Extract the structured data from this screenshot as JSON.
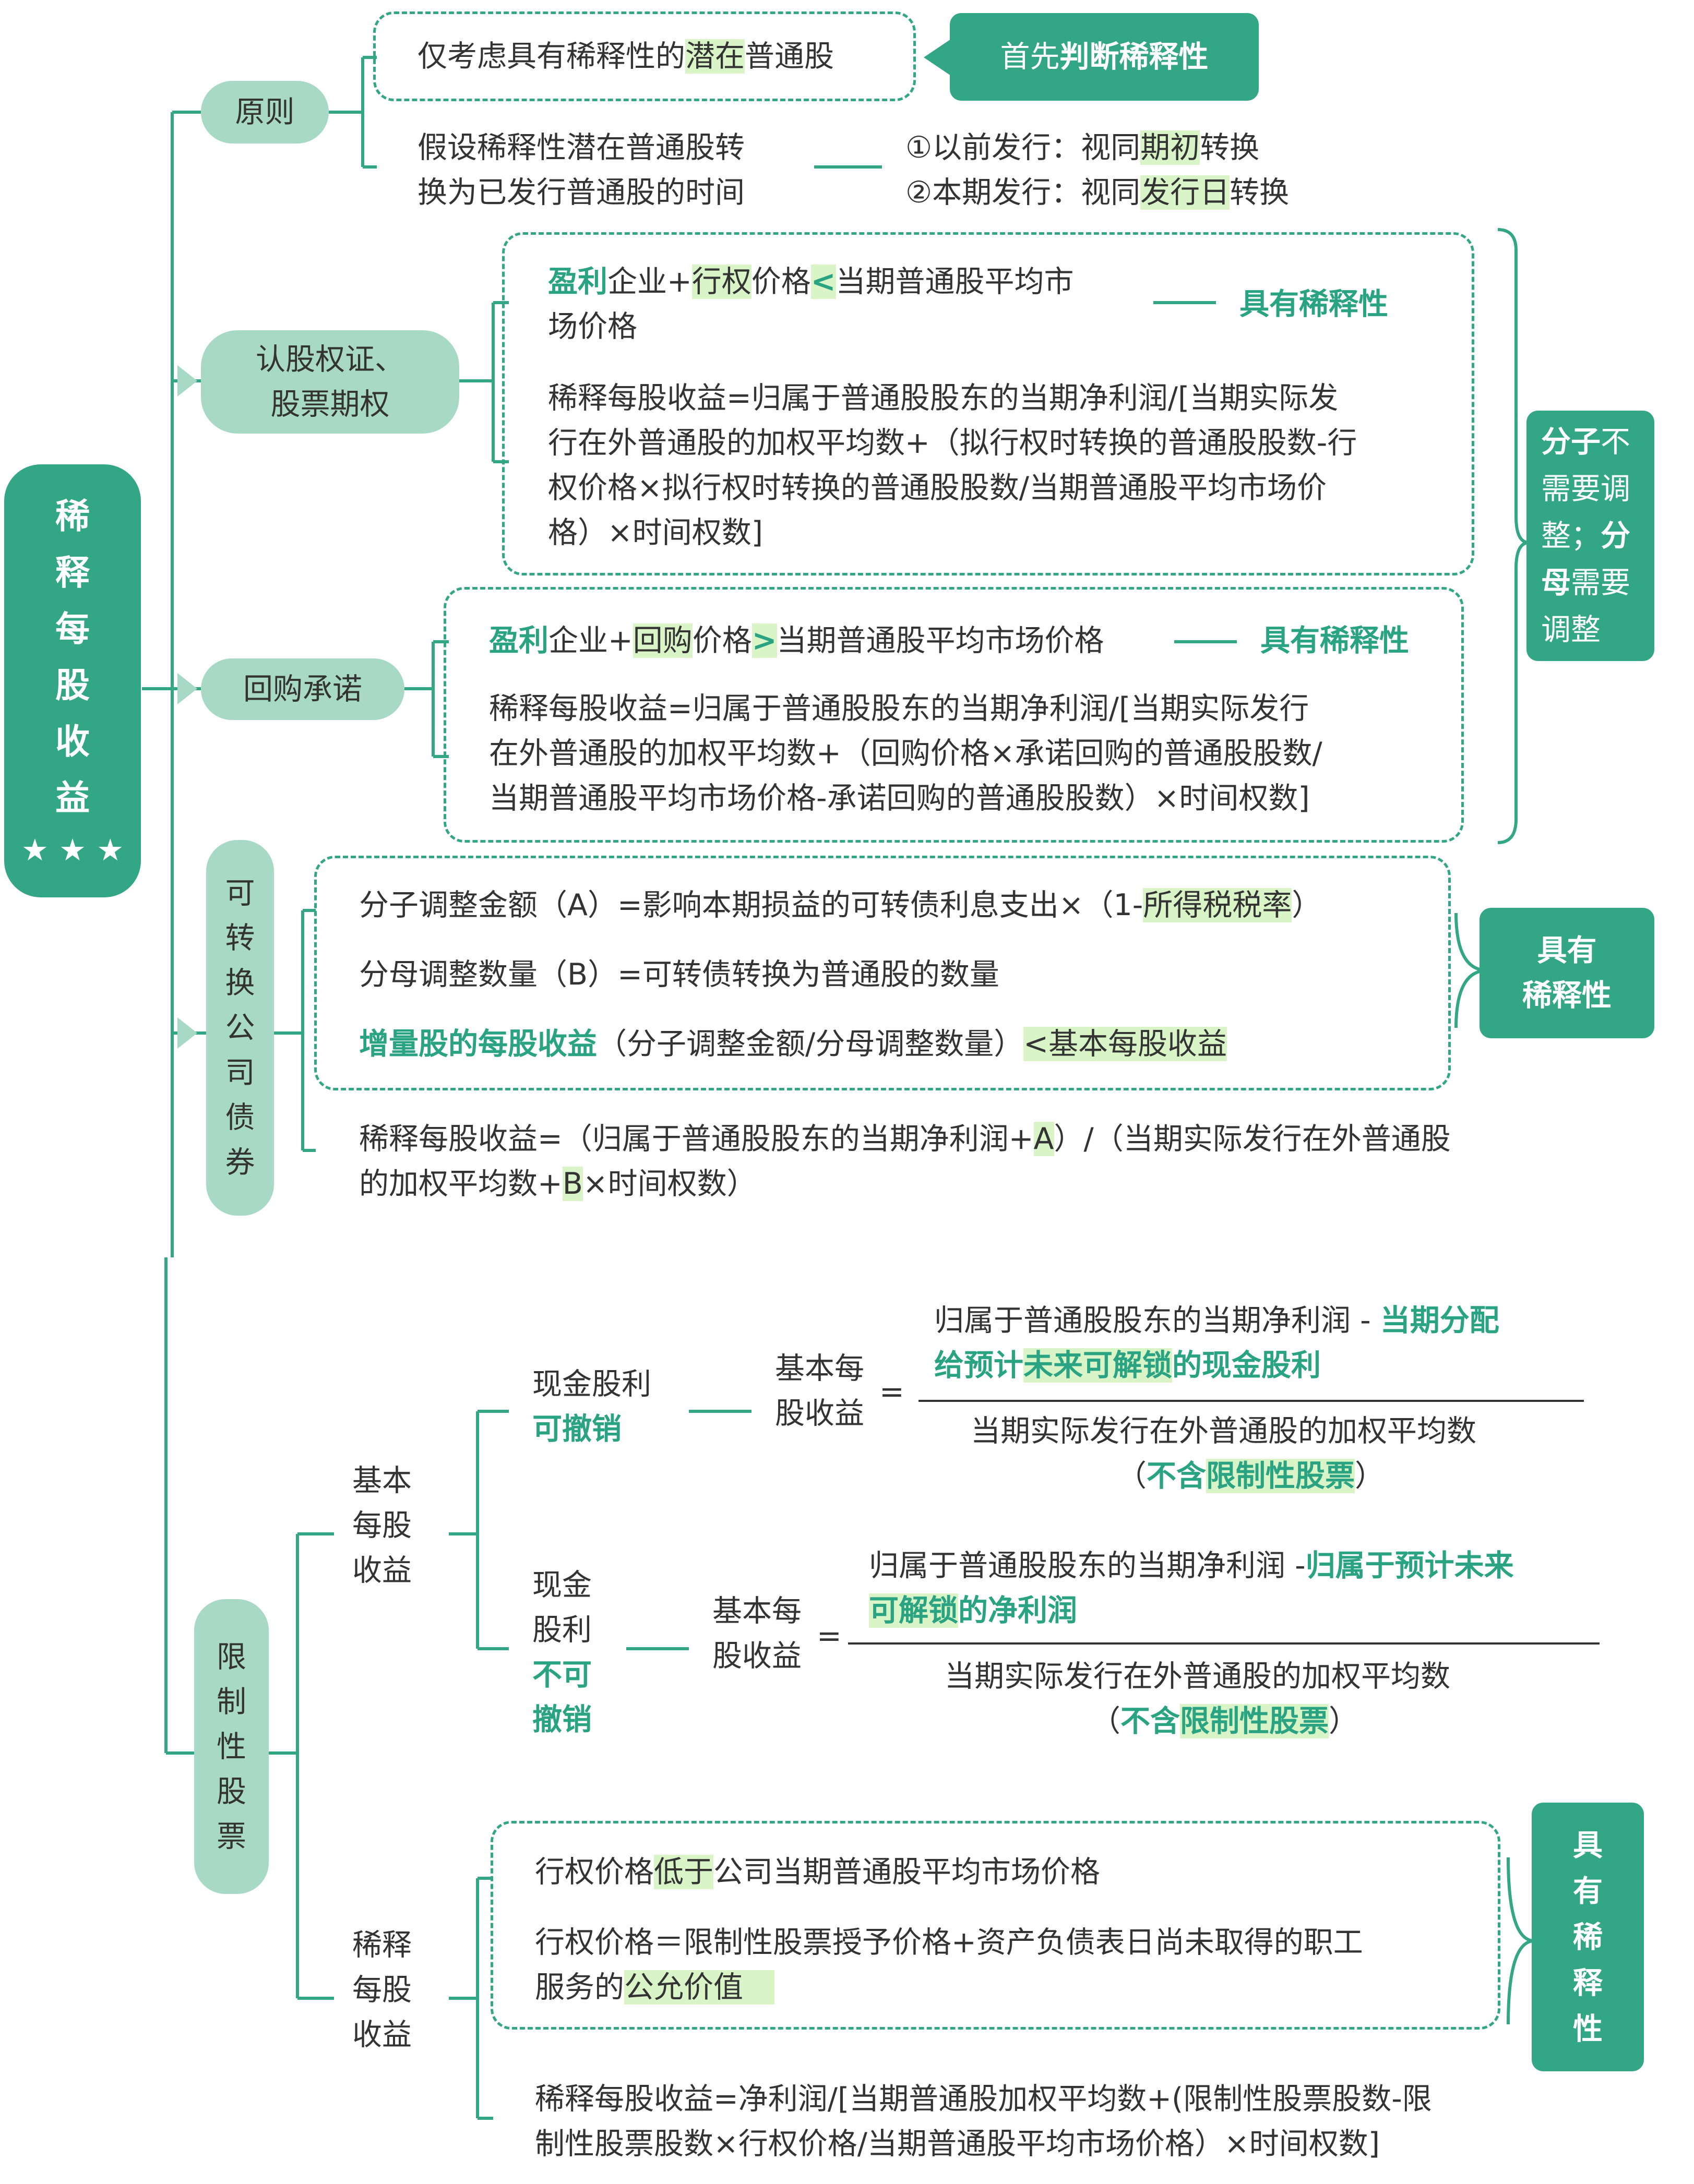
{
  "root": {
    "title_chars": [
      "稀",
      "释",
      "每",
      "股",
      "收",
      "益"
    ],
    "stars": "★ ★ ★"
  },
  "principle": {
    "label": "原则",
    "item1": {
      "pre": "仅考虑具有稀释性的",
      "hl": "潜在",
      "post": "普通股"
    },
    "note1": {
      "pre": "首先",
      "bold": "判断稀释性"
    },
    "item2_line1": "假设稀释性潜在普通股转",
    "item2_line2": "换为已发行普通股的时间",
    "rule1": {
      "pre": "①以前发行：视同",
      "hl": "期初",
      "post": "转换"
    },
    "rule2": {
      "pre": "②本期发行：视同",
      "hl": "发行日",
      "post": "转换"
    }
  },
  "warrants": {
    "label_line1": "认股权证、",
    "label_line2": "股票期权",
    "cond": {
      "g1": "盈利",
      "t1": "企业+",
      "h1": "行权",
      "t2": "价格",
      "h2": "<",
      "t3": "当期普通股平均市",
      "line2": "场价格"
    },
    "result": "具有稀释性",
    "formula": [
      "稀释每股收益=归属于普通股股东的当期净利润/[当期实际发",
      "行在外普通股的加权平均数+（拟行权时转换的普通股股数-行",
      "权价格×拟行权时转换的普通股股数/当期普通股平均市场价",
      "格）×时间权数]"
    ]
  },
  "buyback": {
    "label": "回购承诺",
    "cond": {
      "g1": "盈利",
      "t1": "企业+",
      "h1": "回购",
      "t2": "价格",
      "h2": ">",
      "t3": "当期普通股平均市场价格"
    },
    "result": "具有稀释性",
    "formula": [
      "稀释每股收益=归属于普通股股东的当期净利润/[当期实际发行",
      "在外普通股的加权平均数+（回购价格×承诺回购的普通股股数/",
      "当期普通股平均市场价格-承诺回购的普通股股数）×时间权数]"
    ]
  },
  "side_note": {
    "b1": "分子",
    "t1": "不",
    "t2": "需要调",
    "t3": "整；",
    "b2": "分",
    "b3": "母",
    "t4": "需要",
    "t5": "调整"
  },
  "convertible": {
    "label_chars": [
      "可",
      "转",
      "换",
      "公",
      "司",
      "债",
      "券"
    ],
    "adj_num": {
      "pre": "分子调整金额（A）=影响本期损益的可转债利息支出×（1-",
      "hl": "所得税税率",
      "post": "）"
    },
    "adj_den": "分母调整数量（B）=可转债转换为普通股的数量",
    "incr": {
      "g": "增量股的每股收益",
      "t": "（分子调整金额/分母调整数量）",
      "hl": "<基本每股收益"
    },
    "result_line1": "具有",
    "result_line2": "稀释性",
    "formula_line1": {
      "pre": "稀释每股收益=（归属于普通股股东的当期净利润+",
      "hl": "A",
      "post": "）/（当期实际发行在外普通股"
    },
    "formula_line2": {
      "pre": "的加权平均数+",
      "hl": "B",
      "post": "×时间权数）"
    }
  },
  "restricted": {
    "label_chars": [
      "限",
      "制",
      "性",
      "股",
      "票"
    ],
    "basic_label": [
      "基本",
      "每股",
      "收益"
    ],
    "revocable": {
      "line1": "现金股利",
      "line2": "可撤销",
      "eps_line1": "基本每",
      "eps_line2": "股收益",
      "eq": "=",
      "num_line1": {
        "pre": "归属于普通股股东的当期净利润 - ",
        "g": "当期分配"
      },
      "num_line2": {
        "g1": "给预计",
        "hl": "未来可解锁",
        "g2": "的现金股利"
      },
      "den_line1": "当期实际发行在外普通股的加权平均数",
      "den_line2": {
        "p1": "（",
        "g": "不含",
        "hl": "限制性股票",
        "p2": "）"
      }
    },
    "irrevocable": {
      "line1": "现金",
      "line2": "股利",
      "line3": "不可",
      "line4": "撤销",
      "eps_line1": "基本每",
      "eps_line2": "股收益",
      "eq": "=",
      "num_line1": {
        "pre": "归属于普通股股东的当期净利润 -",
        "g": "归属于预计未来"
      },
      "num_line2": {
        "hl": "可解锁",
        "g": "的净利润"
      },
      "den_line1": "当期实际发行在外普通股的加权平均数",
      "den_line2": {
        "p1": "（",
        "g": "不含",
        "hl": "限制性股票",
        "p2": "）"
      }
    },
    "diluted_label": [
      "稀释",
      "每股",
      "收益"
    ],
    "cond1": {
      "pre": "行权价格",
      "hl": "低于",
      "post": "公司当期普通股平均市场价格"
    },
    "cond2_line1": "行权价格＝限制性股票授予价格+资产负债表日尚未取得的职工",
    "cond2_line2": {
      "pre": "服务的",
      "hl": "公允价值"
    },
    "result_chars": [
      "具",
      "有",
      "稀",
      "释",
      "性"
    ],
    "formula_line1": "稀释每股收益=净利润/[当期普通股加权平均数+(限制性股票股数-限",
    "formula_line2": "制性股票股数×行权价格/当期普通股平均市场价格）×时间权数]"
  },
  "colors": {
    "primary": "#33a685",
    "pill": "#a7d9c6",
    "highlight": "#d9f5c8",
    "text": "#333333"
  }
}
